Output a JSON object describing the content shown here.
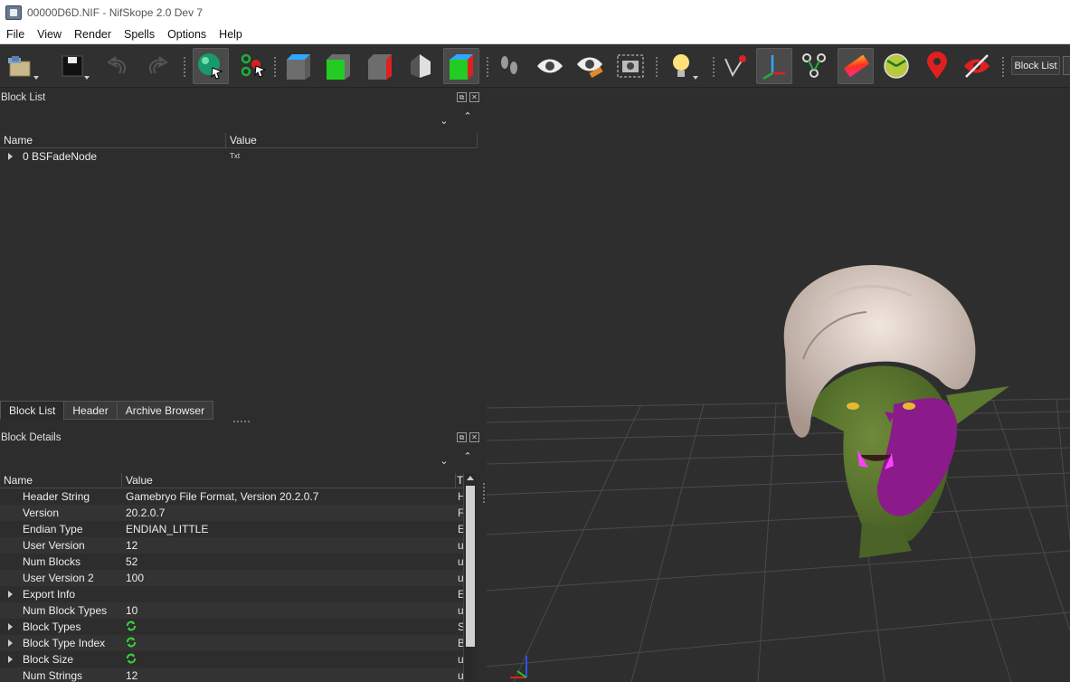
{
  "window": {
    "title": "00000D6D.NIF - NifSkope 2.0 Dev 7"
  },
  "menu": [
    "File",
    "View",
    "Render",
    "Spells",
    "Options",
    "Help"
  ],
  "toolbar": {
    "dock_toggle_label": "Block List"
  },
  "block_list": {
    "title": "Block List",
    "columns": [
      "Name",
      "Value"
    ],
    "rows": [
      {
        "name": "0 BSFadeNode",
        "value": "Txt"
      }
    ]
  },
  "tabs": [
    "Block List",
    "Header",
    "Archive Browser"
  ],
  "block_details": {
    "title": "Block Details",
    "columns": [
      "Name",
      "Value",
      "T"
    ],
    "rows": [
      {
        "name": "Header String",
        "value": "Gamebryo File Format, Version 20.2.0.7",
        "type": "H",
        "expandable": false
      },
      {
        "name": "Version",
        "value": "20.2.0.7",
        "type": "F",
        "expandable": false
      },
      {
        "name": "Endian Type",
        "value": "ENDIAN_LITTLE",
        "type": "E",
        "expandable": false
      },
      {
        "name": "User Version",
        "value": "12",
        "type": "u",
        "expandable": false
      },
      {
        "name": "Num Blocks",
        "value": "52",
        "type": "u",
        "expandable": false
      },
      {
        "name": "User Version 2",
        "value": "100",
        "type": "u",
        "expandable": false
      },
      {
        "name": "Export Info",
        "value": "",
        "type": "E",
        "expandable": true
      },
      {
        "name": "Num Block Types",
        "value": "10",
        "type": "u",
        "expandable": false
      },
      {
        "name": "Block Types",
        "value": "",
        "type": "S",
        "expandable": true,
        "icon": "array-refresh-icon"
      },
      {
        "name": "Block Type Index",
        "value": "",
        "type": "B",
        "expandable": true,
        "icon": "array-refresh-icon"
      },
      {
        "name": "Block Size",
        "value": "",
        "type": "u",
        "expandable": true,
        "icon": "array-refresh-icon"
      },
      {
        "name": "Num Strings",
        "value": "12",
        "type": "u",
        "expandable": false
      }
    ]
  }
}
